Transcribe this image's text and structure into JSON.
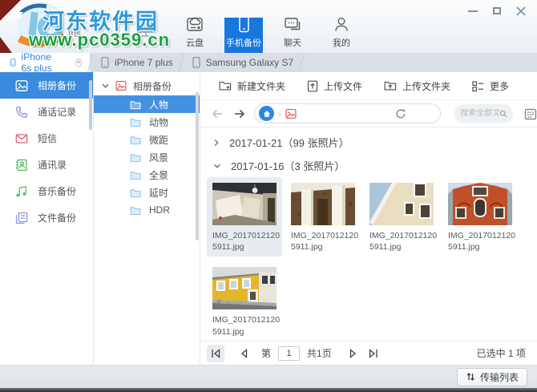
{
  "watermark": {
    "site_name": "河东软件园",
    "site_url": "www.pc0359.cn",
    "app_hint": "Iris"
  },
  "topnav": {
    "items": [
      {
        "label": "云盘"
      },
      {
        "label": "手机备份",
        "active": true
      },
      {
        "label": "聊天"
      },
      {
        "label": "我的"
      }
    ]
  },
  "tabs": {
    "items": [
      {
        "label": "iPhone 6s plus",
        "active": true
      },
      {
        "label": "iPhone 7 plus"
      },
      {
        "label": "Samsung Galaxy S7"
      }
    ]
  },
  "sidebar": {
    "items": [
      {
        "label": "相册备份",
        "active": true
      },
      {
        "label": "通话记录"
      },
      {
        "label": "短信"
      },
      {
        "label": "通讯录"
      },
      {
        "label": "音乐备份"
      },
      {
        "label": "文件备份"
      }
    ]
  },
  "tree": {
    "root_label": "相册备份",
    "folders": [
      {
        "label": "人物",
        "active": true
      },
      {
        "label": "动物"
      },
      {
        "label": "微距"
      },
      {
        "label": "风景"
      },
      {
        "label": "全景"
      },
      {
        "label": "延时"
      },
      {
        "label": "HDR"
      }
    ]
  },
  "toolbar": {
    "new_folder": "新建文件夹",
    "upload_file": "上传文件",
    "upload_folder": "上传文件夹",
    "more": "更多"
  },
  "navbar": {
    "search_placeholder": "搜索全部文件"
  },
  "groups": [
    {
      "label": "2017-01-21（99 张照片）",
      "collapsed": true
    },
    {
      "label": "2017-01-16（3 张照片）",
      "collapsed": false
    }
  ],
  "photos": [
    {
      "name_line1": "IMG_2017012120",
      "name_line2": "5911.jpg",
      "selected": true
    },
    {
      "name_line1": "IMG_2017012120",
      "name_line2": "5911.jpg"
    },
    {
      "name_line1": "IMG_2017012120",
      "name_line2": "5911.jpg"
    },
    {
      "name_line1": "IMG_2017012120",
      "name_line2": "5911.jpg"
    },
    {
      "name_line1": "IMG_2017012120",
      "name_line2": "5911.jpg"
    }
  ],
  "pagination": {
    "page_label": "第",
    "page_value": "1",
    "total_label": "共1页",
    "selection_label": "已选中 1 项"
  },
  "statusbar": {
    "transfer_label": "传输列表"
  },
  "colors": {
    "accent": "#1877dd",
    "sidebar_selected": "#3a8bdd",
    "album_icon_red": "#e05252",
    "watermark_blue": "#2f9ad8",
    "watermark_green": "#1ba043"
  }
}
